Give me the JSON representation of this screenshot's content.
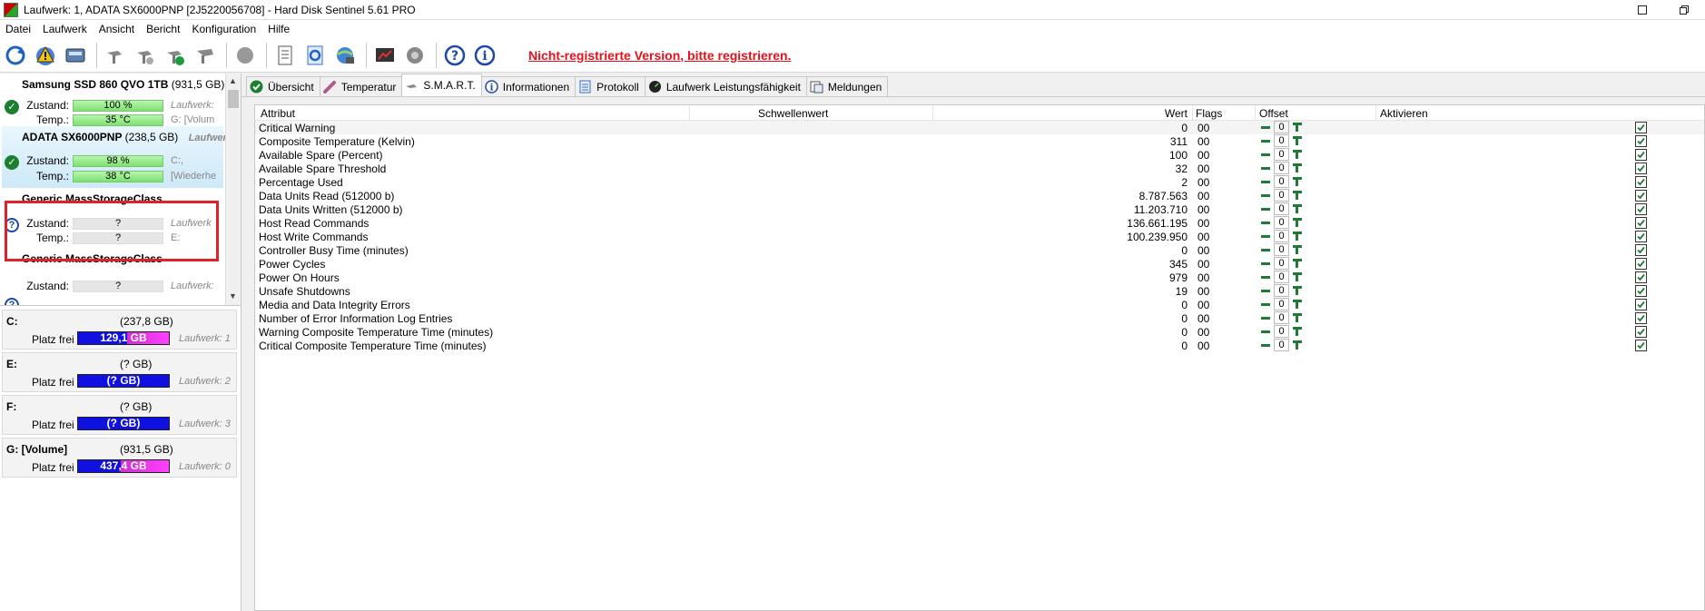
{
  "window": {
    "title": "Laufwerk: 1, ADATA SX6000PNP [2J5220056708]  -  Hard Disk Sentinel 5.61 PRO",
    "minimize_glyph": "🗖",
    "maximize_glyph": "❐"
  },
  "menu": {
    "items": [
      "Datei",
      "Laufwerk",
      "Ansicht",
      "Bericht",
      "Konfiguration",
      "Hilfe"
    ]
  },
  "toolbar": {
    "registration_notice": "Nicht-registrierte Version, bitte registrieren."
  },
  "disks": [
    {
      "name": "Samsung SSD 860 QVO 1TB",
      "size": "(931,5 GB)",
      "zustand_label": "Zustand:",
      "zustand": "100 %",
      "temp_label": "Temp.:",
      "temp": "35 °C",
      "info1": "Laufwerk:",
      "info2": "G: [Volum",
      "status": "ok"
    },
    {
      "name": "ADATA SX6000PNP",
      "size": "(238,5 GB)",
      "zustand_label": "Zustand:",
      "zustand": "98 %",
      "temp_label": "Temp.:",
      "temp": "38 °C",
      "info1": "C:,",
      "info2": "[Wiederhe",
      "status": "ok"
    },
    {
      "name": "Generic MassStorageClass",
      "size": "",
      "zustand_label": "Zustand:",
      "zustand": "?",
      "temp_label": "Temp.:",
      "temp": "?",
      "info1": "Laufwerk",
      "info2": "E:",
      "status": "unknown"
    },
    {
      "name": "Generic MassStorageClass",
      "size": "",
      "zustand_label": "Zustand:",
      "zustand": "?",
      "temp_label": "",
      "temp": "",
      "info1": "Laufwerk:",
      "info2": "",
      "status": "unknown"
    }
  ],
  "volumes": [
    {
      "name": "C:",
      "size": "(237,8 GB)",
      "free_label": "Platz frei",
      "free": "129,1 GB",
      "free_fraction": 0.54,
      "drive": "Laufwerk: 1"
    },
    {
      "name": "E:",
      "size": "(? GB)",
      "free_label": "Platz frei",
      "free": "(? GB)",
      "free_fraction": 1.0,
      "drive": "Laufwerk: 2"
    },
    {
      "name": "F:",
      "size": "(? GB)",
      "free_label": "Platz frei",
      "free": "(? GB)",
      "free_fraction": 1.0,
      "drive": "Laufwerk: 3"
    },
    {
      "name": "G: [Volume]",
      "size": "(931,5 GB)",
      "free_label": "Platz frei",
      "free": "437,4 GB",
      "free_fraction": 0.47,
      "drive": "Laufwerk: 0"
    }
  ],
  "tabs": [
    {
      "label": "Übersicht",
      "icon": "check-circle-icon"
    },
    {
      "label": "Temperatur",
      "icon": "thermometer-icon"
    },
    {
      "label": "S.M.A.R.T.",
      "icon": "smart-disk-icon",
      "active": true
    },
    {
      "label": "Informationen",
      "icon": "info-icon"
    },
    {
      "label": "Protokoll",
      "icon": "log-icon"
    },
    {
      "label": "Laufwerk Leistungsfähigkeit",
      "icon": "performance-icon"
    },
    {
      "label": "Meldungen",
      "icon": "messages-icon"
    }
  ],
  "smart": {
    "columns": {
      "attribut": "Attribut",
      "schwellenwert": "Schwellenwert",
      "wert": "Wert",
      "flags": "Flags",
      "offset": "Offset",
      "aktivieren": "Aktivieren"
    },
    "rows": [
      {
        "attr": "Critical Warning",
        "value": "0",
        "flags": "00",
        "offset": "0"
      },
      {
        "attr": "Composite Temperature (Kelvin)",
        "value": "311",
        "flags": "00",
        "offset": "0"
      },
      {
        "attr": "Available Spare (Percent)",
        "value": "100",
        "flags": "00",
        "offset": "0"
      },
      {
        "attr": "Available Spare Threshold",
        "value": "32",
        "flags": "00",
        "offset": "0"
      },
      {
        "attr": "Percentage Used",
        "value": "2",
        "flags": "00",
        "offset": "0"
      },
      {
        "attr": "Data Units Read (512000 b)",
        "value": "8.787.563",
        "flags": "00",
        "offset": "0"
      },
      {
        "attr": "Data Units Written (512000 b)",
        "value": "11.203.710",
        "flags": "00",
        "offset": "0"
      },
      {
        "attr": "Host Read Commands",
        "value": "136.661.195",
        "flags": "00",
        "offset": "0"
      },
      {
        "attr": "Host Write Commands",
        "value": "100.239.950",
        "flags": "00",
        "offset": "0"
      },
      {
        "attr": "Controller Busy Time (minutes)",
        "value": "0",
        "flags": "00",
        "offset": "0"
      },
      {
        "attr": "Power Cycles",
        "value": "345",
        "flags": "00",
        "offset": "0"
      },
      {
        "attr": "Power On Hours",
        "value": "979",
        "flags": "00",
        "offset": "0"
      },
      {
        "attr": "Unsafe Shutdowns",
        "value": "19",
        "flags": "00",
        "offset": "0"
      },
      {
        "attr": "Media and Data Integrity Errors",
        "value": "0",
        "flags": "00",
        "offset": "0"
      },
      {
        "attr": "Number of Error Information Log Entries",
        "value": "0",
        "flags": "00",
        "offset": "0"
      },
      {
        "attr": "Warning Composite Temperature Time (minutes)",
        "value": "0",
        "flags": "00",
        "offset": "0"
      },
      {
        "attr": "Critical Composite Temperature Time (minutes)",
        "value": "0",
        "flags": "00",
        "offset": "0"
      }
    ]
  },
  "colors": {
    "accent_green": "#1f7a37",
    "notice_red": "#e8101a",
    "free_blue": "#1010e0",
    "used_magenta": "#ff40ff"
  }
}
